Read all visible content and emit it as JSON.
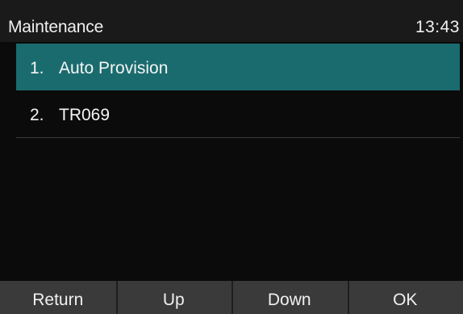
{
  "header": {
    "title": "Maintenance",
    "clock": "13:43"
  },
  "menu": {
    "items": [
      {
        "number": "1.",
        "label": "Auto Provision",
        "selected": true
      },
      {
        "number": "2.",
        "label": "TR069",
        "selected": false
      }
    ]
  },
  "softkeys": {
    "return_label": "Return",
    "up_label": "Up",
    "down_label": "Down",
    "ok_label": "OK"
  },
  "colors": {
    "selection_highlight": "#1a6b6e",
    "background": "#0b0b0b",
    "softkey_bar": "#3a3a3a"
  }
}
